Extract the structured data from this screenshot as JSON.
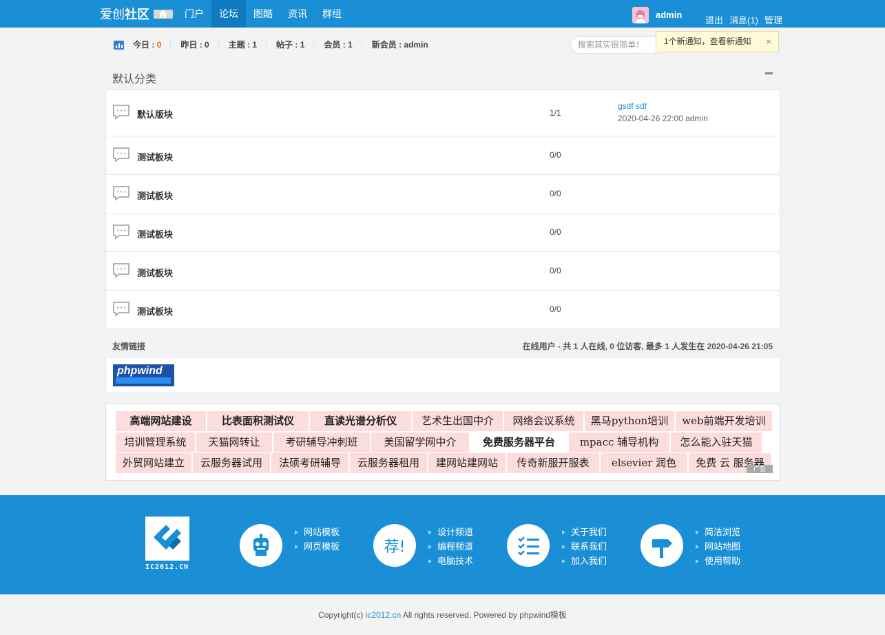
{
  "header": {
    "logo_text_a": "爱创",
    "logo_text_b": "社区",
    "nav": [
      {
        "label": "门户"
      },
      {
        "label": "论坛"
      },
      {
        "label": "图酷"
      },
      {
        "label": "资讯"
      },
      {
        "label": "群组"
      }
    ],
    "username": "admin",
    "links": {
      "logout": "退出",
      "messages": "消息(1)",
      "admin": "管理"
    }
  },
  "stats": {
    "today_label": "今日 : ",
    "today_value": "0",
    "yesterday": "昨日 : 0",
    "topics": "主题 : 1",
    "posts": "帖子 : 1",
    "members": "会员 : 1",
    "new_member": "新会员 : admin"
  },
  "search": {
    "placeholder": "搜索其实很简单！"
  },
  "notice": {
    "text": "1个新通知，查看新通知",
    "close": "×"
  },
  "category": {
    "title": "默认分类"
  },
  "forums": [
    {
      "name": "默认版块",
      "count": "1/1",
      "last_title": "gsdf sdf",
      "last_meta": "2020-04-26 22:00 admin"
    },
    {
      "name": "测试板块",
      "count": "0/0"
    },
    {
      "name": "测试板块",
      "count": "0/0"
    },
    {
      "name": "测试板块",
      "count": "0/0"
    },
    {
      "name": "测试板块",
      "count": "0/0"
    },
    {
      "name": "测试板块",
      "count": "0/0"
    }
  ],
  "friend_links": {
    "label": "友情链接",
    "logo_text": "phpwind",
    "online": "在线用户 - 共 1 人在线, 0 位访客, 最多 1 人发生在 2020-04-26 21:05"
  },
  "ads": [
    [
      "高端网站建设",
      "比表面积测试仪",
      "直读光谱分析仪",
      "艺术生出国中介",
      "网络会议系统",
      "黑马python培训",
      "web前端开发培训"
    ],
    [
      "培训管理系统",
      "天猫网转让",
      "考研辅导冲刺班",
      "美国留学网中介",
      "免费服务器平台",
      "mpacc 辅导机构",
      "怎么能入驻天猫"
    ],
    [
      "外贸网站建立",
      "云服务器试用",
      "法硕考研辅导",
      "云服务器租用",
      "建网站建网站",
      "传奇新服开服表",
      "elsevier 润色",
      "免费 云 服务器"
    ]
  ],
  "ad_mark": "广告",
  "footer": {
    "logo_label": "IC2012.CN",
    "icon_text_2": "荐!",
    "groups": [
      [
        "网站模板",
        "网页模板"
      ],
      [
        "设计频道",
        "编程频道",
        "电脑技术"
      ],
      [
        "关于我们",
        "联系我们",
        "加入我们"
      ],
      [
        "简洁浏览",
        "网站地图",
        "使用帮助"
      ]
    ]
  },
  "copyright": {
    "prefix": "Copyright(c) ",
    "link": "ic2012.cn",
    "suffix": " All rights reserved, Powered by phpwind模板"
  },
  "colors": {
    "brand": "#1a8fd5",
    "nav_active": "#0e7bc1",
    "hot": "#ff6a00",
    "ad_bg": "#fcdcdc"
  }
}
